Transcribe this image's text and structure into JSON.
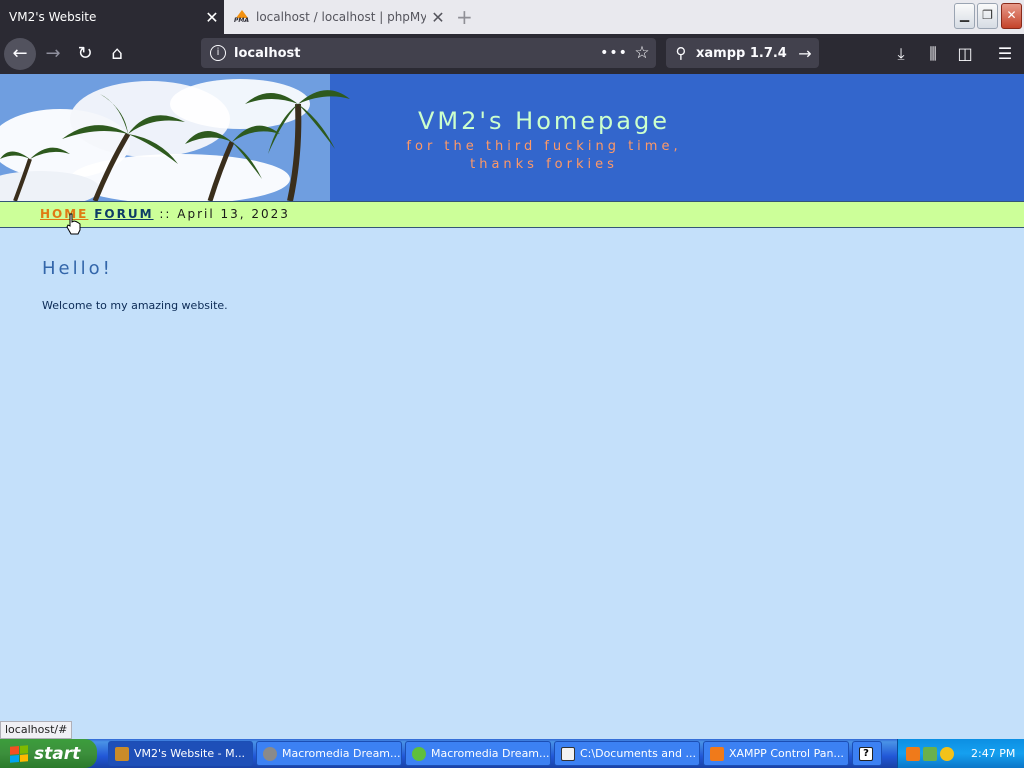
{
  "browser": {
    "tabs": [
      {
        "title": "VM2's Website",
        "active": true
      },
      {
        "title": "localhost / localhost | phpMyAdmin",
        "active": false
      }
    ],
    "url": "localhost",
    "search_text": "xampp 1.7.4",
    "status_tip": "localhost/#"
  },
  "page": {
    "banner_title": "VM2's Homepage",
    "banner_sub1": "for the third fucking time,",
    "banner_sub2": "thanks forkies",
    "nav": {
      "home": "HOME",
      "forum": "FORUM",
      "sep": " :: ",
      "date": "April 13, 2023"
    },
    "heading": "Hello!",
    "intro": "Welcome to my amazing website."
  },
  "taskbar": {
    "start_label": "start",
    "tasks": [
      {
        "label": "VM2's Website - M...",
        "icon_color": "#c98b2a"
      },
      {
        "label": "Macromedia Dream...",
        "icon_color": "#8a8a8a"
      },
      {
        "label": "Macromedia Dream...",
        "icon_color": "#5fbf3c"
      },
      {
        "label": "C:\\Documents and ...",
        "icon_color": "#f2f2f2"
      },
      {
        "label": "XAMPP Control Pan...",
        "icon_color": "#f07a1a"
      }
    ],
    "clock": "2:47 PM"
  },
  "colors": {
    "banner_bg": "#3366cc",
    "nav_strip": "#ccff99",
    "page_bg": "#c4e0fa",
    "title": "#ccffcc",
    "subtitle": "#ff9966"
  }
}
